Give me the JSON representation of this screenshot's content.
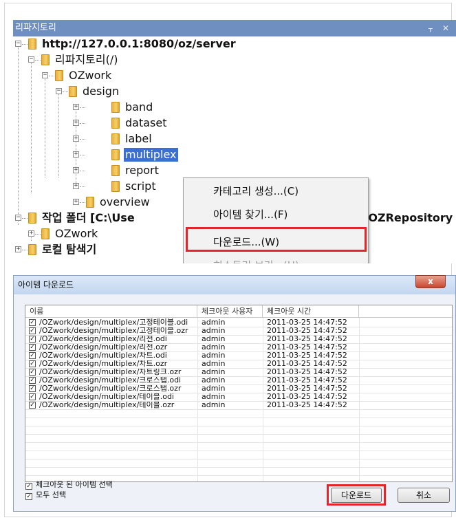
{
  "panel": {
    "title": "리파지토리",
    "pin_icon": "pin-icon",
    "close_icon": "close-icon"
  },
  "tree": {
    "nodes": [
      {
        "label": "http://127.0.0.1:8080/oz/server",
        "expander": "−",
        "bold": true
      },
      {
        "label": "리파지토리(/)",
        "expander": "−"
      },
      {
        "label": "OZwork",
        "expander": "−"
      },
      {
        "label": "design",
        "expander": "−"
      },
      {
        "label": "band",
        "expander": "+"
      },
      {
        "label": "dataset",
        "expander": "+"
      },
      {
        "label": "label",
        "expander": "+"
      },
      {
        "label": "multiplex",
        "expander": "+",
        "selected": true
      },
      {
        "label": "report",
        "expander": "+"
      },
      {
        "label": "script",
        "expander": "+"
      },
      {
        "label": "overview",
        "expander": "+"
      },
      {
        "label": "작업 폴더 [C:\\Use",
        "expander": "−",
        "bold": true
      },
      {
        "label": "OZwork",
        "expander": "+"
      },
      {
        "label": "로컬 탐색기",
        "expander": "+",
        "bold": true
      }
    ],
    "truncated_suffix": "s\\OZRepository"
  },
  "context_menu": {
    "items": [
      {
        "label": "카테고리 생성...(C)",
        "enabled": true
      },
      {
        "label": "아이템 찾기...(F)",
        "enabled": true
      },
      {
        "label": "다운로드...(W)",
        "enabled": true,
        "highlighted": true
      },
      {
        "label": "히스토리 보기...(H)",
        "enabled": false
      }
    ]
  },
  "dialog": {
    "title": "아이템 다운로드",
    "columns": [
      "이름",
      "체크아웃 사용자",
      "체크아웃 시간"
    ],
    "rows": [
      {
        "name": "/OZwork/design/multiplex/고정테이블.odi",
        "user": "admin",
        "time": "2011-03-25 14:47:52"
      },
      {
        "name": "/OZwork/design/multiplex/고정테이블.ozr",
        "user": "admin",
        "time": "2011-03-25 14:47:52"
      },
      {
        "name": "/OZwork/design/multiplex/리전.odi",
        "user": "admin",
        "time": "2011-03-25 14:47:52"
      },
      {
        "name": "/OZwork/design/multiplex/리전.ozr",
        "user": "admin",
        "time": "2011-03-25 14:47:52"
      },
      {
        "name": "/OZwork/design/multiplex/차트.odi",
        "user": "admin",
        "time": "2011-03-25 14:47:52"
      },
      {
        "name": "/OZwork/design/multiplex/차트.ozr",
        "user": "admin",
        "time": "2011-03-25 14:47:52"
      },
      {
        "name": "/OZwork/design/multiplex/차트링크.ozr",
        "user": "admin",
        "time": "2011-03-25 14:47:52"
      },
      {
        "name": "/OZwork/design/multiplex/크로스탭.odi",
        "user": "admin",
        "time": "2011-03-25 14:47:52"
      },
      {
        "name": "/OZwork/design/multiplex/크로스탭.ozr",
        "user": "admin",
        "time": "2011-03-25 14:47:52"
      },
      {
        "name": "/OZwork/design/multiplex/테이블.odi",
        "user": "admin",
        "time": "2011-03-25 14:47:52"
      },
      {
        "name": "/OZwork/design/multiplex/테이블.ozr",
        "user": "admin",
        "time": "2011-03-25 14:47:52"
      }
    ],
    "check_symbol": "✓",
    "select_checked_out_label": "체크아웃 된 아이템 선택",
    "select_all_label": "모두 선택",
    "download_button": "다운로드",
    "cancel_button": "취소",
    "close_symbol": "x"
  },
  "colors": {
    "panel_title_bg": "#6f8fc0",
    "selection": "#3b6fd1",
    "highlight_box": "#e3242b"
  }
}
